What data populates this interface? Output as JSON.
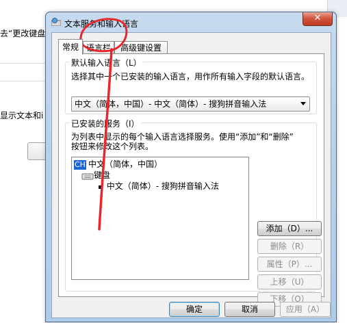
{
  "background_window": {
    "text_1": "去“更改键盘",
    "text_2": "显示文本和i"
  },
  "dialog": {
    "title": "文本服务和输入语言",
    "close_glyph": "✕",
    "tabs": [
      {
        "label": "常规"
      },
      {
        "label": "语言栏"
      },
      {
        "label": "高级键设置"
      }
    ],
    "default_language": {
      "title": "默认输入语言（L）",
      "description": "选择其中一个已安装的输入语言，用作所有输入字段的默认语言。",
      "selected": "中文（简体，中国）- 中文（简体）- 搜狗拼音输入法"
    },
    "installed_services": {
      "title": "已安装的服务（I）",
      "description_line1": "为列表中显示的每个输入语言选择服务。使用“添加”和“删除”",
      "description_line2": "按钮来修改这个列表。",
      "tree": {
        "language_badge": "CH",
        "language": "中文（简体，中国）",
        "category": "键盘",
        "service": "中文（简体）- 搜狗拼音输入法"
      },
      "buttons": {
        "add": "添加（D）...",
        "remove": "删除（R）",
        "properties": "属性（P）...",
        "move_up": "上移（U）",
        "move_down": "下移（O）"
      }
    },
    "footer": {
      "ok": "确定",
      "cancel": "取消",
      "apply": "应用（A）"
    }
  },
  "colors": {
    "annotation_red": "#e8262b",
    "language_badge": "#1a66d6"
  }
}
